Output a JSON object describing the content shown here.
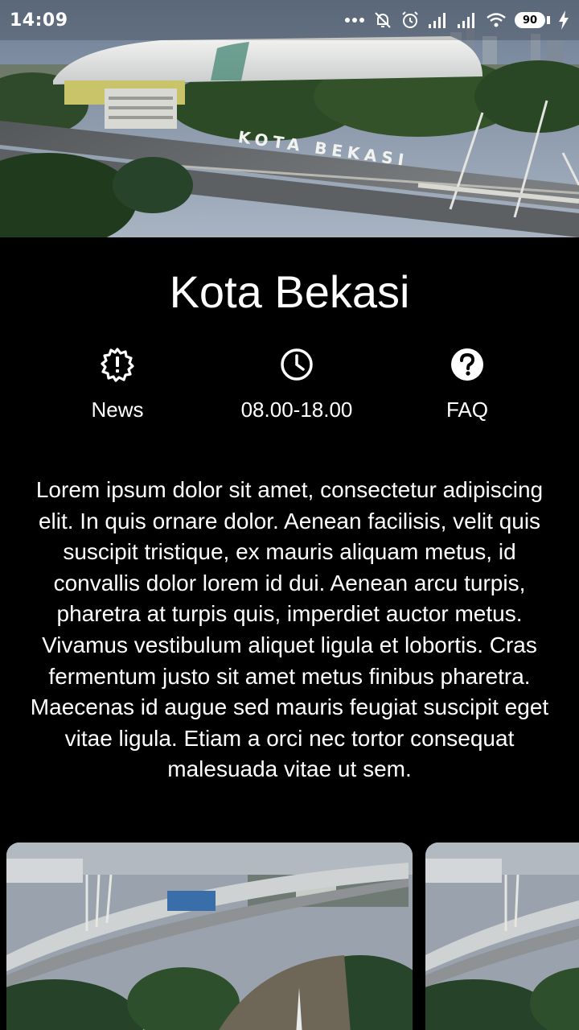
{
  "status_bar": {
    "time": "14:09",
    "battery_level": "90",
    "icons": [
      "more-dots-icon",
      "notifications-off-icon",
      "alarm-icon",
      "signal-icon",
      "signal-icon",
      "wifi-icon",
      "battery-icon",
      "charging-icon"
    ]
  },
  "hero": {
    "sign_text": "KOTA BEKASI",
    "image_icon": "stadium-photo"
  },
  "page": {
    "title": "Kota Bekasi"
  },
  "info": [
    {
      "label": "News",
      "icon": "alert-badge-icon"
    },
    {
      "label": "08.00-18.00",
      "icon": "clock-icon"
    },
    {
      "label": "FAQ",
      "icon": "help-circle-icon"
    }
  ],
  "description": "Lorem ipsum dolor sit amet, consectetur adipiscing elit. In quis ornare dolor. Aenean facilisis, velit quis suscipit tristique, ex mauris aliquam metus, id convallis dolor lorem id dui. Aenean arcu turpis, pharetra at turpis quis, imperdiet auctor metus. Vivamus vestibulum aliquet ligula et lobortis. Cras fermentum justo sit amet metus finibus pharetra. Maecenas id augue sed mauris feugiat suscipit eget vitae ligula. Etiam a orci nec tortor consequat malesuada vitae ut sem.",
  "gallery": {
    "images": [
      "flyover-park-photo",
      "flyover-park-photo"
    ]
  },
  "colors": {
    "background": "#000000",
    "text": "#ffffff"
  }
}
